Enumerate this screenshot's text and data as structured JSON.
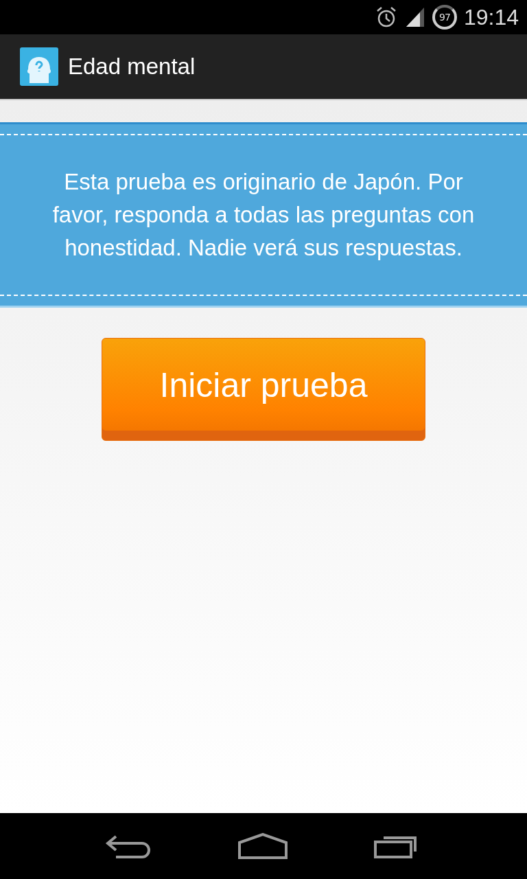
{
  "status_bar": {
    "battery": "97",
    "time": "19:14"
  },
  "action_bar": {
    "title": "Edad mental"
  },
  "banner": {
    "text": "Esta prueba es originario de Japón. Por favor, responda a todas las preguntas con honestidad. Nadie verá sus respuestas."
  },
  "start_button": {
    "label": "Iniciar prueba"
  }
}
